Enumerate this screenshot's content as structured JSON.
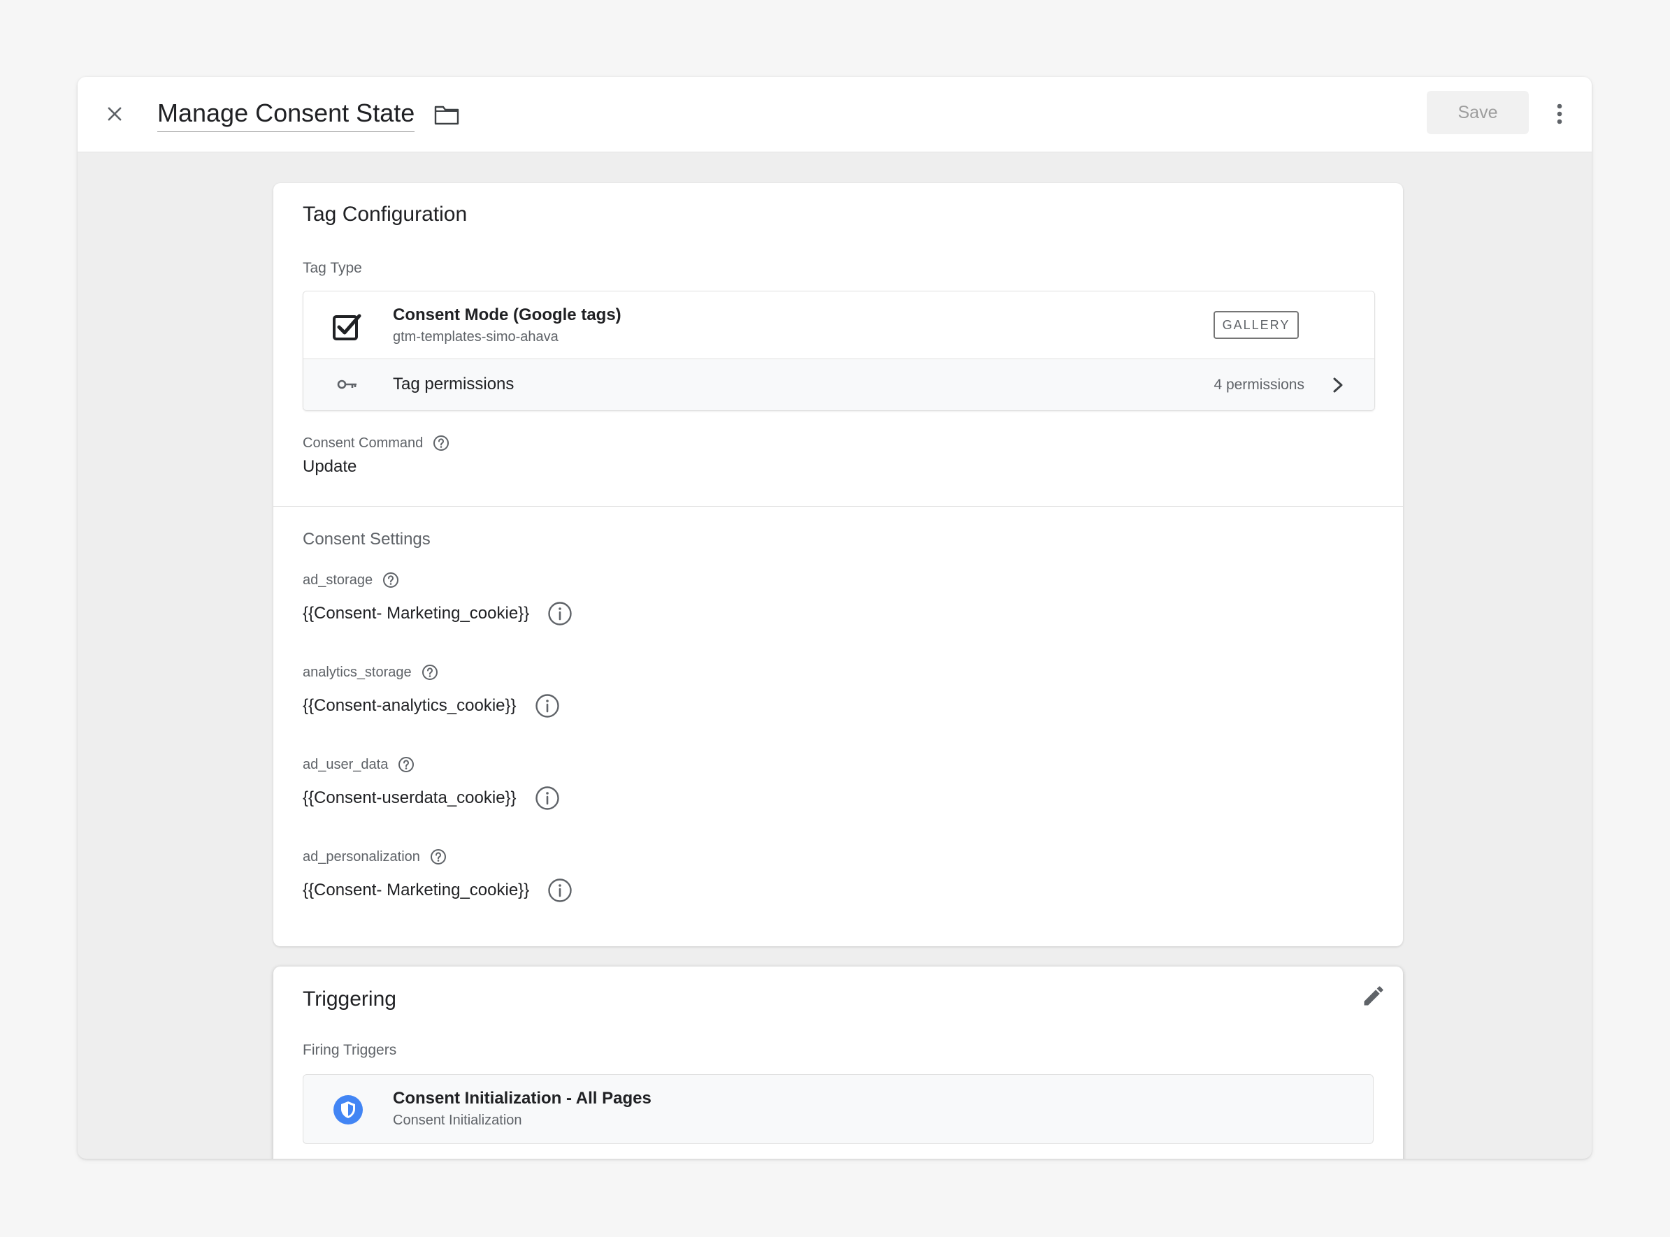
{
  "header": {
    "title": "Manage Consent State",
    "save_label": "Save"
  },
  "tag_configuration": {
    "title": "Tag Configuration",
    "tag_type_label": "Tag Type",
    "tag_type": {
      "name": "Consent Mode (Google tags)",
      "publisher": "gtm-templates-simo-ahava",
      "badge": "GALLERY",
      "icon": "checkbox-checked-icon"
    },
    "permissions": {
      "label": "Tag permissions",
      "count": "4 permissions",
      "icon": "key-icon"
    },
    "consent_command": {
      "label": "Consent Command",
      "value": "Update"
    },
    "consent_settings": {
      "title": "Consent Settings",
      "items": [
        {
          "label": "ad_storage",
          "value": "{{Consent- Marketing_cookie}}"
        },
        {
          "label": "analytics_storage",
          "value": "{{Consent-analytics_cookie}}"
        },
        {
          "label": "ad_user_data",
          "value": "{{Consent-userdata_cookie}}"
        },
        {
          "label": "ad_personalization",
          "value": "{{Consent- Marketing_cookie}}"
        }
      ]
    }
  },
  "triggering": {
    "title": "Triggering",
    "firing_label": "Firing Triggers",
    "triggers": [
      {
        "name": "Consent Initialization - All Pages",
        "type": "Consent Initialization",
        "icon": "shield-icon",
        "icon_color": "#4285f4"
      }
    ]
  },
  "colors": {
    "accent_blue": "#4285f4",
    "text_primary": "#202124",
    "text_secondary": "#5f6368"
  }
}
